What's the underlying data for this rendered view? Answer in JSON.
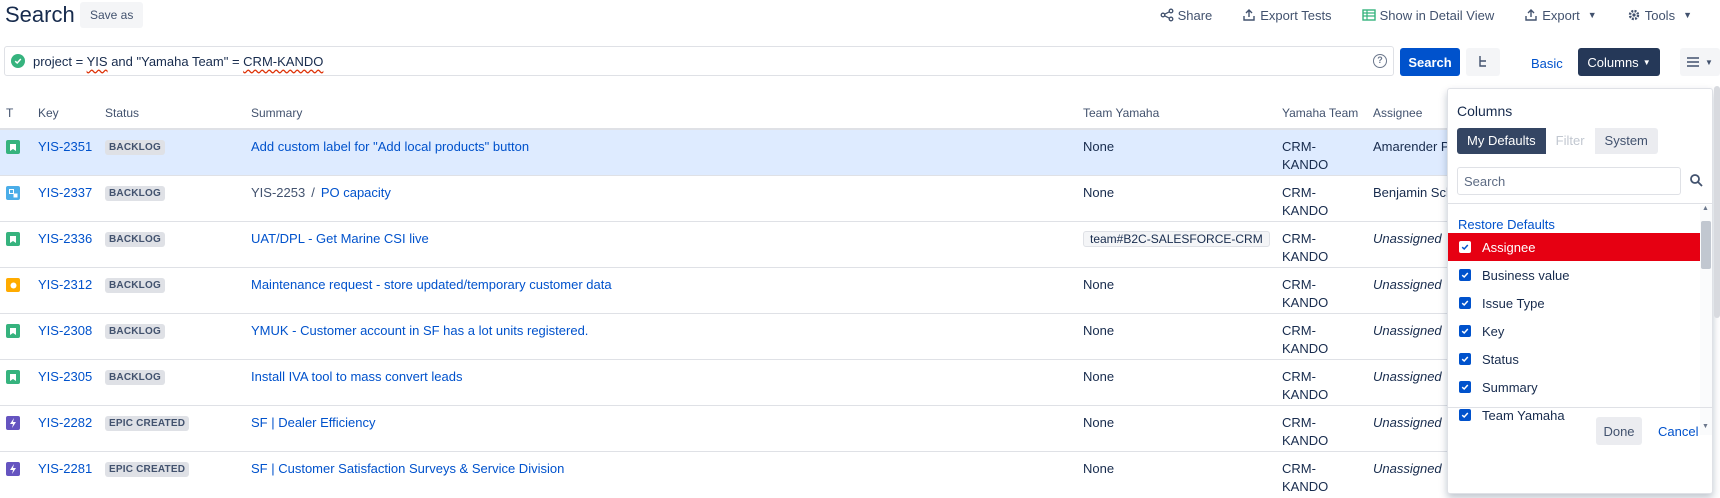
{
  "header": {
    "title": "Search",
    "save_as": "Save as",
    "actions": {
      "share": "Share",
      "export_tests": "Export Tests",
      "detail_view": "Show in Detail View",
      "export": "Export",
      "tools": "Tools"
    }
  },
  "query": {
    "prefix": "project = ",
    "project": "YIS",
    "mid": " and \"Yamaha Team\" = ",
    "team": "CRM-KANDO",
    "search_label": "Search",
    "basic_label": "Basic",
    "columns_label": "Columns"
  },
  "table": {
    "headers": {
      "type": "T",
      "key": "Key",
      "status": "Status",
      "summary": "Summary",
      "team_yamaha": "Team Yamaha",
      "yamaha_team": "Yamaha Team",
      "assignee": "Assignee"
    },
    "rows": [
      {
        "type": "story",
        "key": "YIS-2351",
        "status": "BACKLOG",
        "summary": "Add custom label for \"Add local products\" button",
        "team_yamaha": "None",
        "yamaha_team_1": "CRM-",
        "yamaha_team_2": "KANDO",
        "assignee": "Amarender Pa"
      },
      {
        "type": "subtask",
        "key": "YIS-2337",
        "status": "BACKLOG",
        "parent": "YIS-2253",
        "sep": "/",
        "summary": "PO capacity",
        "team_yamaha": "None",
        "yamaha_team_1": "CRM-",
        "yamaha_team_2": "KANDO",
        "assignee": "Benjamin Sch"
      },
      {
        "type": "story",
        "key": "YIS-2336",
        "status": "BACKLOG",
        "summary": "UAT/DPL - Get Marine CSI live",
        "team_yamaha": "team#B2C-SALESFORCE-CRM",
        "yamaha_team_1": "CRM-",
        "yamaha_team_2": "KANDO",
        "assignee": "Unassigned"
      },
      {
        "type": "maintenance",
        "key": "YIS-2312",
        "status": "BACKLOG",
        "summary": "Maintenance request - store updated/temporary customer data",
        "team_yamaha": "None",
        "yamaha_team_1": "CRM-",
        "yamaha_team_2": "KANDO",
        "assignee": "Unassigned"
      },
      {
        "type": "story",
        "key": "YIS-2308",
        "status": "BACKLOG",
        "summary": "YMUK - Customer account in SF has a lot units registered.",
        "team_yamaha": "None",
        "yamaha_team_1": "CRM-",
        "yamaha_team_2": "KANDO",
        "assignee": "Unassigned"
      },
      {
        "type": "story",
        "key": "YIS-2305",
        "status": "BACKLOG",
        "summary": "Install IVA tool to mass convert leads",
        "team_yamaha": "None",
        "yamaha_team_1": "CRM-",
        "yamaha_team_2": "KANDO",
        "assignee": "Unassigned"
      },
      {
        "type": "epic",
        "key": "YIS-2282",
        "status": "EPIC CREATED",
        "summary": "SF | Dealer Efficiency",
        "team_yamaha": "None",
        "yamaha_team_1": "CRM-",
        "yamaha_team_2": "KANDO",
        "assignee": "Unassigned"
      },
      {
        "type": "epic",
        "key": "YIS-2281",
        "status": "EPIC CREATED",
        "summary": "SF | Customer Satisfaction Surveys & Service Division",
        "team_yamaha": "None",
        "yamaha_team_1": "CRM-",
        "yamaha_team_2": "KANDO",
        "assignee": "Unassigned"
      }
    ]
  },
  "columns_popup": {
    "title": "Columns",
    "tabs": {
      "my_defaults": "My Defaults",
      "filter": "Filter",
      "system": "System"
    },
    "search_placeholder": "Search",
    "restore": "Restore Defaults",
    "items": [
      "Assignee",
      "Business value",
      "Issue Type",
      "Key",
      "Status",
      "Summary",
      "Team Yamaha"
    ],
    "done": "Done",
    "cancel": "Cancel"
  },
  "colors": {
    "primary": "#0052cc",
    "selected_row": "#deebff",
    "highlight_item": "#e60012",
    "columns_button": "#253858",
    "story_icon": "#36b37e",
    "subtask_icon": "#4bade8",
    "maintenance_icon": "#ffab00",
    "epic_icon": "#6554c0"
  }
}
